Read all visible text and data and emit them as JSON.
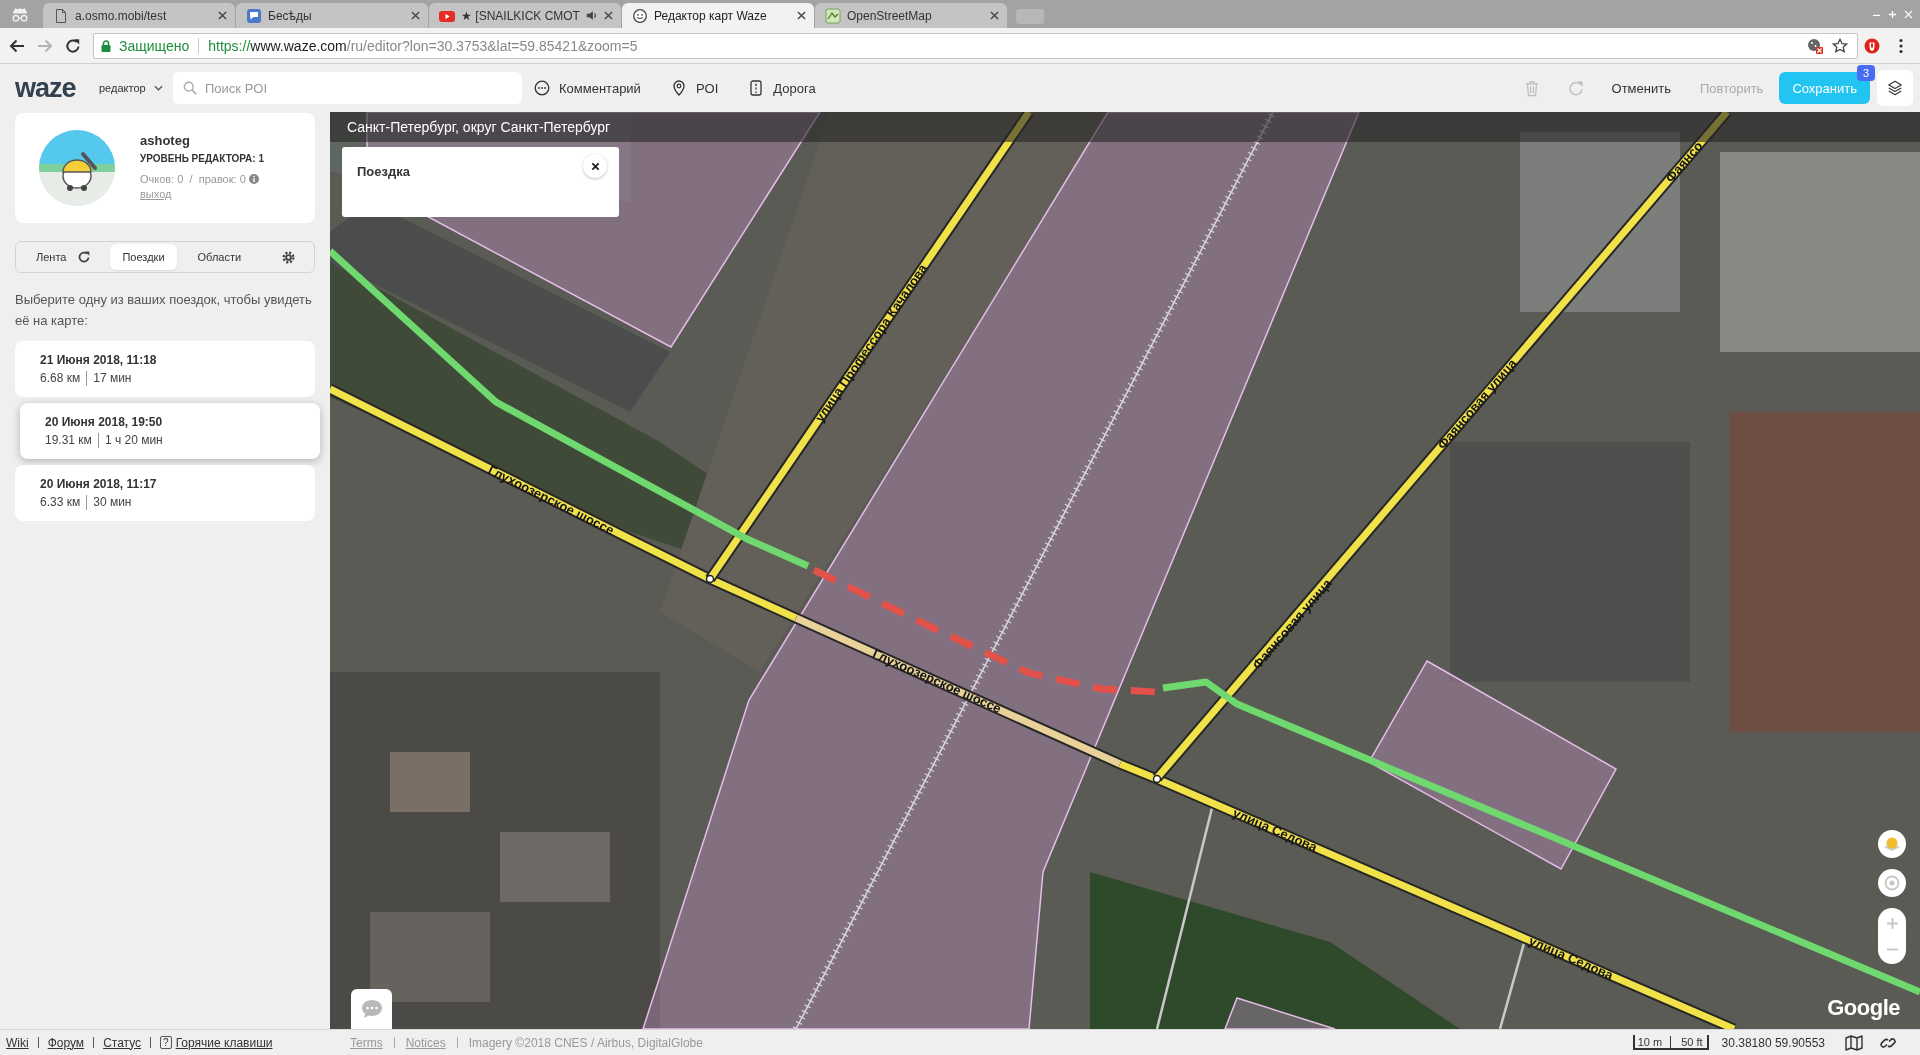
{
  "browser": {
    "tabs": [
      {
        "title": "a.osmo.mobi/test",
        "kind": "document",
        "audio": false,
        "selected": false
      },
      {
        "title": "Бесѣды",
        "kind": "chat",
        "audio": false,
        "selected": false
      },
      {
        "title": "★ [SNAILKICK СМОТ",
        "kind": "video",
        "audio": true,
        "selected": false
      },
      {
        "title": "Редактор карт Waze",
        "kind": "waze",
        "audio": false,
        "selected": true
      },
      {
        "title": "OpenStreetMap",
        "kind": "map",
        "audio": false,
        "selected": false
      }
    ],
    "navigation": [
      {
        "kind": "back",
        "disabled": false
      },
      {
        "kind": "forward",
        "disabled": true
      },
      {
        "kind": "reload",
        "disabled": false
      }
    ],
    "address": {
      "security": "Защищено",
      "scheme": "https://",
      "host": "www.waze.com",
      "path": "/ru/editor?lon=30.3753&lat=59.85421&zoom=5"
    }
  },
  "toolbar": {
    "logo": "waze",
    "mode": "редактор",
    "search": {
      "placeholder": "Поиск POI"
    },
    "tools": [
      {
        "kind": "comment",
        "label": "Комментарий"
      },
      {
        "kind": "poi",
        "label": "POI"
      },
      {
        "kind": "road",
        "label": "Дорога"
      }
    ],
    "icon_actions": [
      {
        "kind": "delete",
        "disabled": true
      },
      {
        "kind": "reload",
        "disabled": true
      }
    ],
    "undo": {
      "label": "Отменить",
      "disabled": false
    },
    "redo": {
      "label": "Повторить",
      "disabled": true
    },
    "save": {
      "label": "Сохранить",
      "badge": "3"
    }
  },
  "profile": {
    "username": "ashoteg",
    "level": "УРОВЕНЬ РЕДАКТОРА: 1",
    "stats": "Очков: 0  /  правок: 0",
    "logout": "выход"
  },
  "sidebar_tabs": [
    {
      "label": "Лента",
      "kind": "feed",
      "selected": false
    },
    {
      "label": "Поездки",
      "kind": "plain",
      "selected": true
    },
    {
      "label": "Области",
      "kind": "plain",
      "selected": false
    }
  ],
  "trips": {
    "hint": "Выберите одну из ваших поездок, чтобы увидеть её на карте:",
    "items": [
      {
        "date": "21 Июня 2018, 11:18",
        "distance": "6.68 км",
        "duration": "17 мин",
        "selected": false
      },
      {
        "date": "20 Июня 2018, 19:50",
        "distance": "19.31 км",
        "duration": "1 ч 20 мин",
        "selected": true
      },
      {
        "date": "20 Июня 2018, 11:17",
        "distance": "6.33 км",
        "duration": "30 мин",
        "selected": false
      }
    ]
  },
  "map": {
    "location": "Санкт-Петербург, округ Санкт-Петербург",
    "popup": {
      "title": "Поездка"
    },
    "road_labels": [
      "Глухоозерское шоссе",
      "улица Профессора Качалова",
      "Глухоозерское шоссе",
      "Фаянсовая улица",
      "Фаянсовая улица",
      "Фаянсо",
      "улица Седова",
      "улица Седова"
    ],
    "logo": "Google"
  },
  "footer": {
    "links": [
      {
        "label": "Wiki",
        "kind": "link"
      },
      {
        "label": "Форум",
        "kind": "link"
      },
      {
        "label": "Статус",
        "kind": "link"
      },
      {
        "label": "Горячие клавиши",
        "kind": "shortcuts",
        "key": "?"
      }
    ],
    "legal": [
      "Terms",
      "Notices"
    ],
    "attribution": "Imagery ©2018 CNES / Airbus, DigitalGlobe",
    "scale": {
      "metric": "10 m",
      "imperial": "50 ft"
    },
    "coordinates": "30.38180 59.90553"
  }
}
